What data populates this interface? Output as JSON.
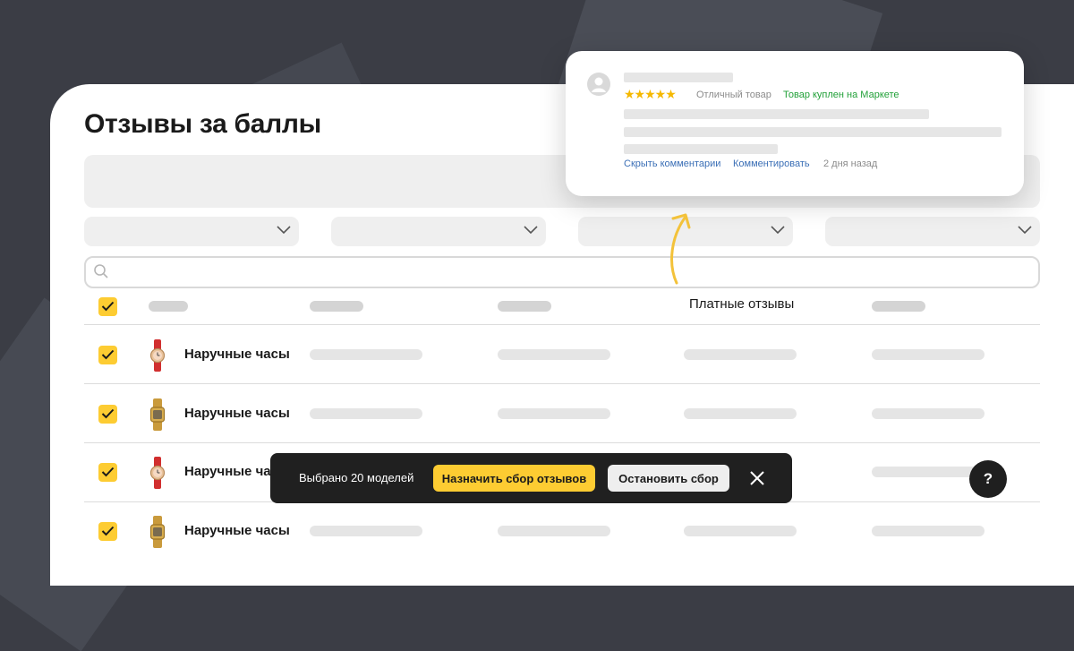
{
  "page": {
    "title": "Отзывы за баллы"
  },
  "review_card": {
    "stars": "★★★★★",
    "rating_text": "Отличный товар",
    "bought_badge": "Товар куплен на Маркете",
    "hide_comments_link": "Скрыть комментарии",
    "comment_link": "Комментировать",
    "date": "2 дня назад"
  },
  "table": {
    "paid_reviews_header": "Платные отзывы",
    "rows": [
      {
        "name": "Наручные часы",
        "watch_color": "red"
      },
      {
        "name": "Наручные часы",
        "watch_color": "gold"
      },
      {
        "name": "Наручные часы",
        "watch_color": "red"
      },
      {
        "name": "Наручные часы",
        "watch_color": "gold"
      }
    ]
  },
  "action_bar": {
    "selected_text": "Выбрано 20 моделей",
    "assign_button": "Назначить сбор отзывов",
    "stop_button": "Остановить сбор"
  },
  "help": {
    "label": "?"
  },
  "colors": {
    "accent": "#fdcc32",
    "link": "#3b6fb6",
    "success": "#21a038",
    "star": "#f5b800"
  }
}
